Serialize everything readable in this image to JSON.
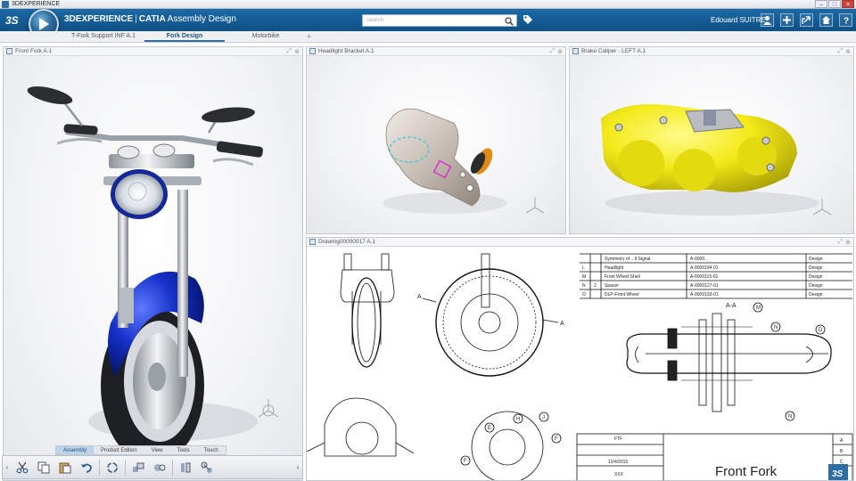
{
  "os": {
    "title": "3DEXPERIENCE"
  },
  "header": {
    "brand_strong": "3DEXPERIENCE",
    "separator": "|",
    "app_strong": "CATIA",
    "app_name": "Assembly Design",
    "search_placeholder": "Search",
    "user_name": "Edouard SUITRE"
  },
  "tabs": [
    {
      "label": "T-Fork Support INF A.1",
      "active": false
    },
    {
      "label": "Fork Design",
      "active": true
    },
    {
      "label": "Motorbike",
      "active": false
    }
  ],
  "tab_add": "+",
  "panels": {
    "front_fork": {
      "title": "Front Fork A.1"
    },
    "headlight": {
      "title": "Headlight Bracket A.1"
    },
    "caliper": {
      "title": "Brake Caliper - LEFT A.1"
    },
    "drawing": {
      "title": "Drawing00000017 A.1"
    }
  },
  "action_tabs": [
    {
      "label": "Assembly",
      "active": true
    },
    {
      "label": "Product Edition",
      "active": false
    },
    {
      "label": "View",
      "active": false
    },
    {
      "label": "Tools",
      "active": false
    },
    {
      "label": "Touch",
      "active": false
    }
  ],
  "drawing": {
    "section_label": "A-A",
    "view_marker": "A",
    "bom": [
      {
        "item": "",
        "qty": "",
        "name": "Symmetry of  ...lt Signal",
        "part": "A-0000...",
        "type": "Design"
      },
      {
        "item": "L",
        "qty": "",
        "name": "Headlight",
        "part": "A-0000194 01",
        "type": "Design"
      },
      {
        "item": "M",
        "qty": "",
        "name": "Front Wheel Shell",
        "part": "A-0000115-01",
        "type": "Design"
      },
      {
        "item": "N",
        "qty": "2",
        "name": "Spacer",
        "part": "A-0000127-01",
        "type": "Design"
      },
      {
        "item": "O",
        "qty": "",
        "name": "DLP-Front Wheel",
        "part": "A-0000193-01",
        "type": "Design"
      }
    ],
    "balloons": [
      "M",
      "N",
      "D",
      "N",
      "E",
      "H",
      "J",
      "F",
      "F"
    ],
    "title_block": {
      "title": "Front Fork",
      "code": "FTF",
      "date": "12/4/2015",
      "drawn": "XXX",
      "rev_letters": [
        "A",
        "B",
        "C",
        "D"
      ]
    }
  },
  "colors": {
    "header_top": "#1c6aa7",
    "header_bottom": "#0f4f84",
    "fork_blue": "#1530c8",
    "caliper_yellow": "#f2ea18",
    "accent": "#2d6fa5"
  },
  "icons": {
    "brand": "ds-logo-icon",
    "compass": "compass-play-icon",
    "search": "search-icon",
    "tag": "tag-icon",
    "header_buttons": [
      "user-icon",
      "add-icon",
      "share-icon",
      "home-icon",
      "help-icon"
    ],
    "toolbar": [
      "scissors-icon",
      "copy-icon",
      "paste-icon",
      "undo-icon",
      "update-icon",
      "assembly-icon",
      "constraint-icon",
      "explode-icon",
      "snap-icon"
    ]
  }
}
